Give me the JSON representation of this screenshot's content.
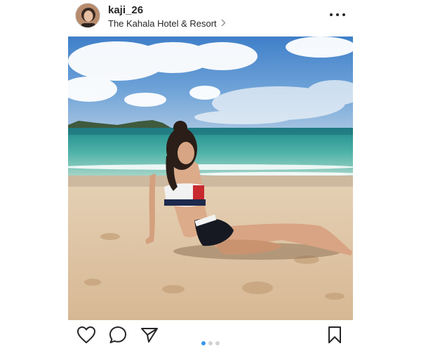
{
  "post": {
    "username": "kaji_26",
    "location": "The Kahala Hotel & Resort",
    "photo_description": "",
    "carousel": {
      "count": 3,
      "active_index": 0
    }
  },
  "icons": {
    "more": "more-horizontal-icon",
    "like": "heart-icon",
    "comment": "comment-bubble-icon",
    "share": "paper-plane-icon",
    "save": "bookmark-icon",
    "location_chevron": "chevron-right-icon"
  },
  "colors": {
    "text": "#262626",
    "carousel_active": "#3897f0",
    "carousel_inactive": "#d2d2d2"
  }
}
